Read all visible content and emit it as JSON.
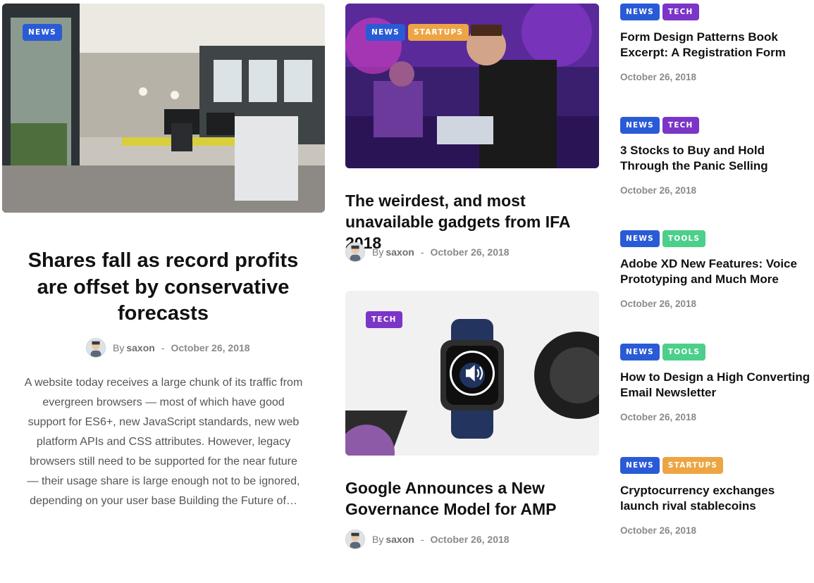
{
  "colors": {
    "news": "#2a5bd7",
    "tech": "#7b35c7",
    "startups": "#eda544",
    "tools": "#4ccf8a"
  },
  "featured": {
    "badges": [
      "NEWS"
    ],
    "title": "Shares fall as record profits are offset by conservative forecasts",
    "by": "By",
    "author": "saxon",
    "dash": "-",
    "date": "October 26, 2018",
    "excerpt": "A website today receives a large chunk of its traffic from evergreen browsers — most of which have good support for ES6+, new JavaScript standards, new web platform APIs and CSS attributes. However, legacy browsers still need to be supported for the near future — their usage share is large enough not to be ignored, depending on your user base Building the Future of…"
  },
  "middle": [
    {
      "badges": [
        "NEWS",
        "STARTUPS"
      ],
      "title": "The weirdest, and most unavailable gadgets from IFA 2018",
      "by": "By",
      "author": "saxon",
      "dash": "-",
      "date": "October 26, 2018"
    },
    {
      "badges": [
        "TECH"
      ],
      "title": "Google Announces a New Governance Model for AMP",
      "by": "By",
      "author": "saxon",
      "dash": "-",
      "date": "October 26, 2018",
      "icon": "audio-play-icon"
    }
  ],
  "sidebar": [
    {
      "badges": [
        "NEWS",
        "TECH"
      ],
      "title": "Form Design Patterns Book Excerpt: A Registration Form",
      "date": "October 26, 2018"
    },
    {
      "badges": [
        "NEWS",
        "TECH"
      ],
      "title": "3 Stocks to Buy and Hold Through the Panic Selling",
      "date": "October 26, 2018"
    },
    {
      "badges": [
        "NEWS",
        "TOOLS"
      ],
      "title": "Adobe XD New Features: Voice Prototyping and Much More",
      "date": "October 26, 2018"
    },
    {
      "badges": [
        "NEWS",
        "TOOLS"
      ],
      "title": "How to Design a High Converting Email Newsletter",
      "date": "October 26, 2018"
    },
    {
      "badges": [
        "NEWS",
        "STARTUPS"
      ],
      "title": "Cryptocurrency exchanges launch rival stablecoins",
      "date": "October 26, 2018"
    }
  ]
}
